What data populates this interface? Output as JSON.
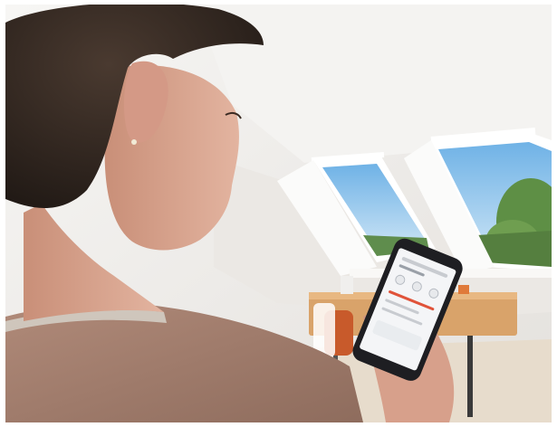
{
  "scene": {
    "colors": {
      "wall": "#f2f0ed",
      "ceiling": "#f6f5f3",
      "sky": "#8fc4ea",
      "trees": "#5e8f45",
      "desk": "#d9a36a",
      "chair": "#c85a2b",
      "sweater": "#a77e6c",
      "hair": "#2e2520",
      "skin": "#d7a08b",
      "phone": "#1e1e22",
      "screen": "#f4f5f7",
      "accent": "#e0533a"
    },
    "icons": [
      "window-icon",
      "smartphone-icon",
      "desk-icon",
      "chair-icon"
    ]
  }
}
